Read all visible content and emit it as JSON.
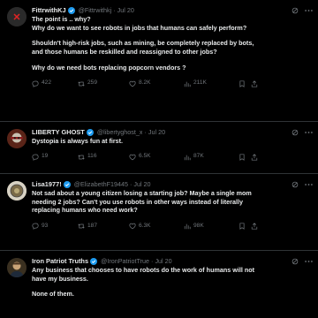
{
  "tweets": [
    {
      "name": "FittrwithKJ",
      "handle": "@Fittrwithkj",
      "time": "Jul 20",
      "lines": [
        "The point is .. why?",
        "Why do we want to see robots in jobs that humans can safely perform?",
        "Shouldn't high-risk jobs, such as mining, be completely replaced by bots,",
        "and those humans be reskilled and reassigned to other jobs?",
        "Why do we need bots replacing popcorn vendors ?"
      ],
      "replies": "422",
      "reposts": "259",
      "likes": "8.2K",
      "views": "211K"
    },
    {
      "name": "LIBERTY GHOST",
      "handle": "@libertyghost_x",
      "time": "Jul 20",
      "lines": [
        "Dystopia is always fun at first."
      ],
      "replies": "19",
      "reposts": "116",
      "likes": "6.5K",
      "views": "87K"
    },
    {
      "name": "Lisa1977!",
      "handle": "@ElizabethF19445",
      "time": "Jul 20",
      "lines": [
        "Not sad about a young citizen losing a starting job? Maybe a single mom",
        "needing 2 jobs? Can't you use robots in other ways instead of literally",
        "replacing humans who need work?"
      ],
      "replies": "93",
      "reposts": "187",
      "likes": "6.3K",
      "views": "98K"
    },
    {
      "name": "Iron Patriot Truths",
      "handle": "@IronPatriotTrue",
      "time": "Jul 20",
      "lines": [
        "Any business that chooses to have robots do the work of humans will not",
        "have my business.",
        "None of them."
      ]
    }
  ],
  "colors": {
    "background": "#000000",
    "text": "#e7e9ea",
    "muted": "#71767b",
    "divider": "#2f3336",
    "verified": "#1d9bf0"
  },
  "icons": [
    "reply-icon",
    "repost-icon",
    "like-icon",
    "views-icon",
    "bookmark-icon",
    "share-icon",
    "grok-icon",
    "more-icon",
    "verified-icon"
  ]
}
